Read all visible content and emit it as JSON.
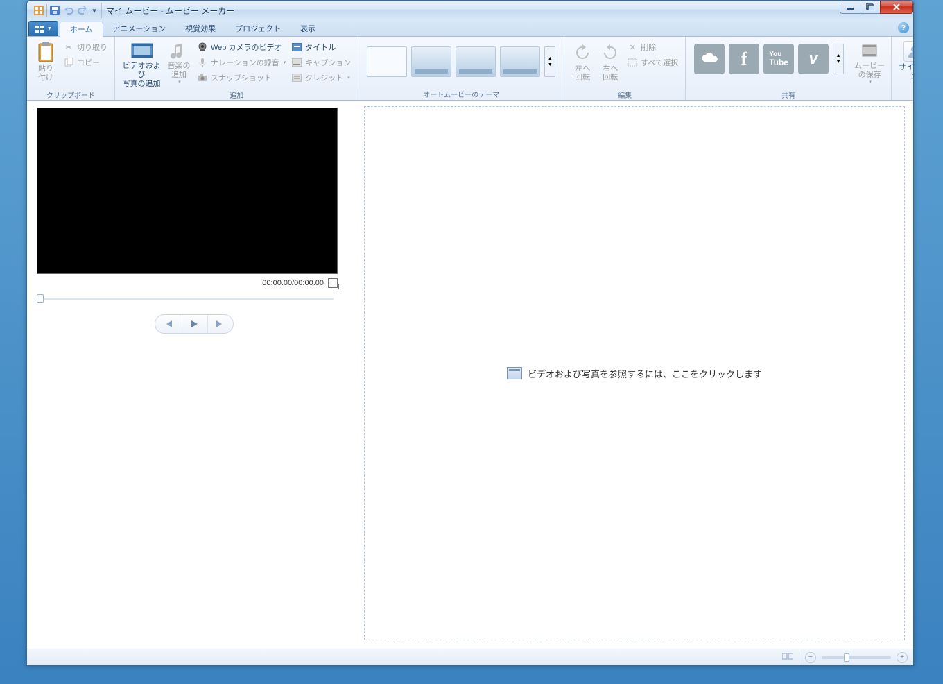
{
  "window": {
    "title": "マイ ムービー - ムービー メーカー"
  },
  "tabs": {
    "home": "ホーム",
    "animation": "アニメーション",
    "visual": "視覚効果",
    "project": "プロジェクト",
    "view": "表示"
  },
  "groups": {
    "clipboard": {
      "label": "クリップボード",
      "paste": "貼り\n付け",
      "cut": "切り取り",
      "copy": "コピー"
    },
    "add": {
      "label": "追加",
      "media": "ビデオおよび\n写真の追加",
      "music": "音楽の\n追加",
      "webcam": "Web カメラのビデオ",
      "narration": "ナレーションの録音",
      "snapshot": "スナップショット",
      "title": "タイトル",
      "caption": "キャプション",
      "credit": "クレジット"
    },
    "themes": {
      "label": "オートムービーのテーマ"
    },
    "edit": {
      "label": "編集",
      "rotate_left": "左へ\n回転",
      "rotate_right": "右へ\n回転",
      "delete": "削除",
      "select_all": "すべて選択"
    },
    "share": {
      "label": "共有",
      "save": "ムービー\nの保存",
      "signin": "サインイン"
    }
  },
  "preview": {
    "time": "00:00.00/00:00.00"
  },
  "timeline": {
    "placeholder": "ビデオおよび写真を参照するには、ここをクリックします"
  }
}
